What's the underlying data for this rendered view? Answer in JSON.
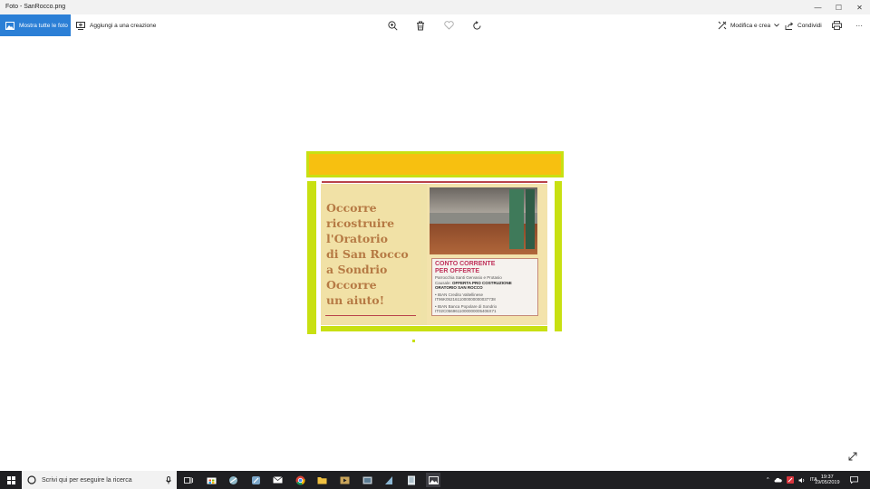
{
  "window": {
    "title": "Foto - SanRocco.png",
    "controls": {
      "minimize": "—",
      "maximize": "☐",
      "close": "✕"
    }
  },
  "toolbar": {
    "show_all_label": "Mostra tutte le foto",
    "add_to_creation_label": "Aggiungi a una creazione",
    "edit_create_label": "Modifica e crea",
    "share_label": "Condividi",
    "more_label": "···"
  },
  "poster": {
    "headline": [
      "Occorre",
      "ricostruire",
      "l'Oratorio",
      "di San Rocco",
      "a Sondrio",
      "Occorre",
      "un aiuto!"
    ],
    "card_title_1": "CONTO CORRENTE",
    "card_title_2": "PER OFFERTE",
    "card_line1": "Parrocchia Santi Gervasio e Protasio",
    "card_causale_label": "Causale:",
    "card_causale_1": "OFFERTA PRO COSTRUZIONE",
    "card_causale_2": "ORATORIO SAN ROCCO",
    "iban1_label": "• IBAN Credito Valtellinese",
    "iban1_value": "IT96K0521611000000000037738",
    "iban2_label": "• IBAN Banca Popolare di Sondrio",
    "iban2_value": "IT02C0569611000000005406X71"
  },
  "taskbar": {
    "search_placeholder": "Scrivi qui per eseguire la ricerca",
    "language": "ITA",
    "time": "19:37",
    "date": "19/05/2019"
  },
  "colors": {
    "accent": "#2b7fd6",
    "poster_yellow": "#f7c010",
    "poster_green": "#c8e012",
    "headline_brown": "#b67a44",
    "card_red": "#c0325a"
  }
}
